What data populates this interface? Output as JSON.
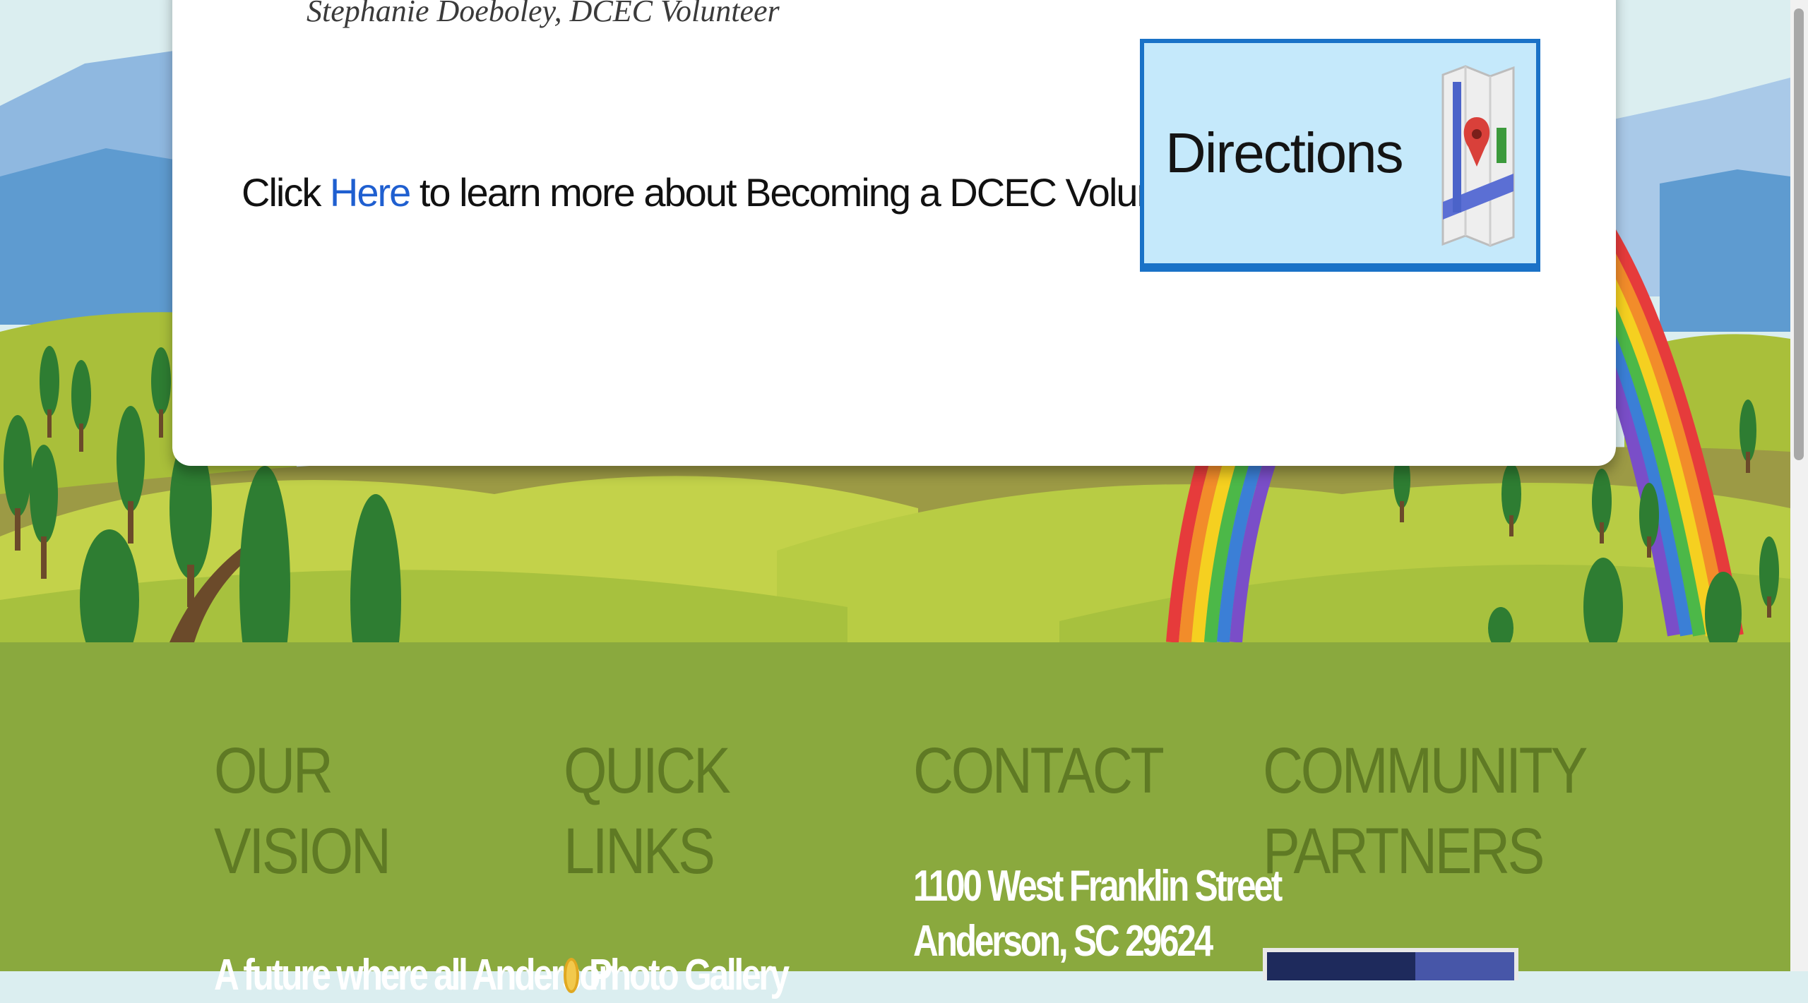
{
  "testimonial": {
    "attribution": "Stephanie Doeboley, DCEC Volunteer"
  },
  "volunteer": {
    "prefix": "Click ",
    "link_text": "Here",
    "suffix": " to learn more about Becoming a DCEC Volunteer!"
  },
  "directions_button": {
    "label": "Directions",
    "icon": "map-pin-icon"
  },
  "footer": {
    "vision": {
      "heading": "OUR VISION",
      "text": "A future where all Anderson"
    },
    "quick_links": {
      "heading": "QUICK LINKS",
      "items": [
        {
          "label": "Photo Gallery",
          "icon": "bullet-icon"
        }
      ]
    },
    "contact": {
      "heading": "CONTACT",
      "address_line1": "1100 West Franklin Street",
      "address_line2": "Anderson, SC 29624"
    },
    "partners": {
      "heading_line1": "COMMUNITY",
      "heading_line2": "PARTNERS"
    }
  },
  "colors": {
    "footer_bg": "#8aa93e",
    "footer_heading": "#5f7a24",
    "directions_bg": "#c5e9fb",
    "directions_border": "#1a72c7",
    "link": "#1f5fd0"
  }
}
